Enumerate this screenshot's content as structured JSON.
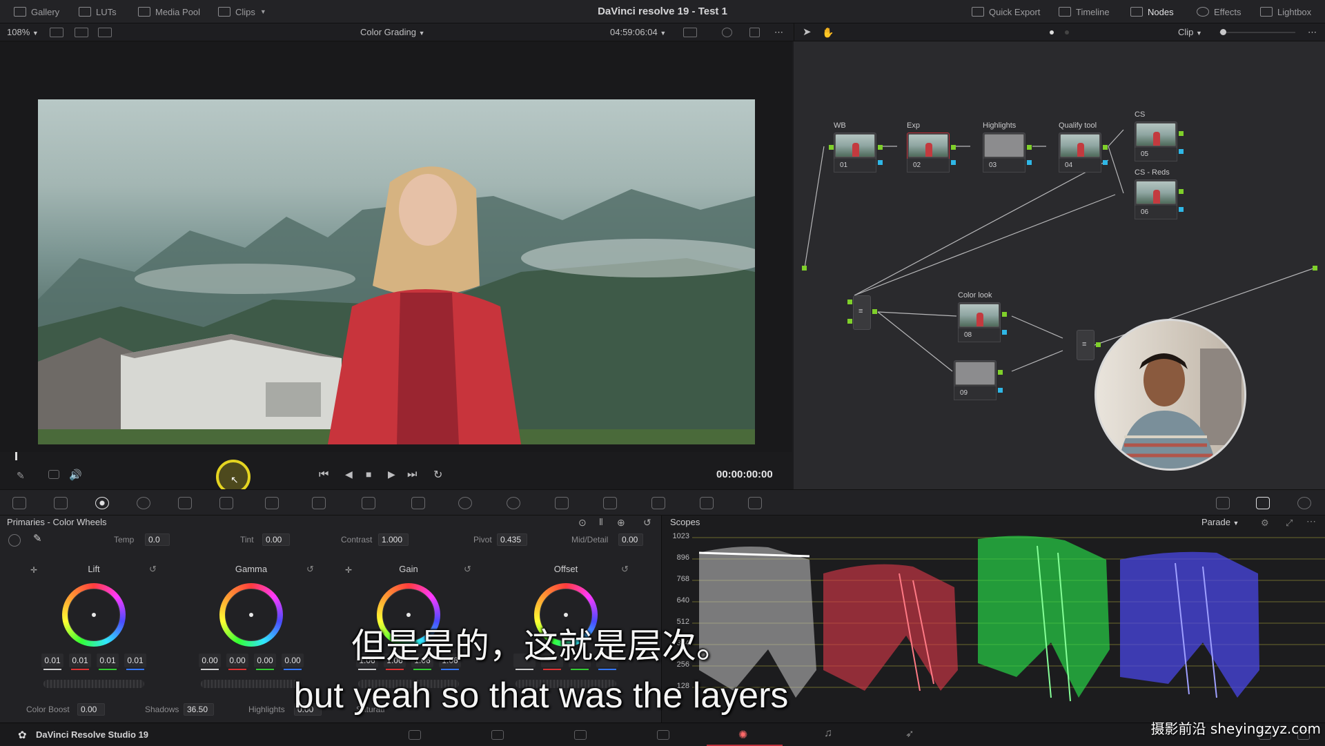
{
  "topbar": {
    "tabs": [
      {
        "label": "Gallery",
        "icon": "gallery-icon"
      },
      {
        "label": "LUTs",
        "icon": "luts-icon"
      },
      {
        "label": "Media Pool",
        "icon": "media-pool-icon"
      },
      {
        "label": "Clips",
        "icon": "clips-icon"
      }
    ],
    "title": "DaVinci resolve 19 - Test 1",
    "right_tabs": [
      {
        "label": "Quick Export",
        "icon": "export-icon"
      },
      {
        "label": "Timeline",
        "icon": "timeline-icon"
      },
      {
        "label": "Nodes",
        "icon": "nodes-icon"
      },
      {
        "label": "Effects",
        "icon": "fx-icon"
      },
      {
        "label": "Lightbox",
        "icon": "lightbox-icon"
      }
    ]
  },
  "viewer_toolbar": {
    "zoom": "108%",
    "mode": "Color Grading",
    "timecode": "04:59:06:04",
    "clip_mode": "Clip"
  },
  "transport": {
    "timecode": "00:00:00:00"
  },
  "nodes": {
    "labels": {
      "wb": "WB",
      "exp": "Exp",
      "highlights": "Highlights",
      "qualify": "Qualify tool",
      "cs": "CS",
      "cs_reds": "CS - Reds",
      "color_look": "Color look"
    },
    "numbers": {
      "wb": "01",
      "exp": "02",
      "highlights": "03",
      "qualify": "04",
      "cs": "05",
      "cs_reds": "06",
      "color_look": "08",
      "unnamed": "09"
    }
  },
  "primaries": {
    "title": "Primaries - Color Wheels",
    "temp_label": "Temp",
    "temp": "0.0",
    "tint_label": "Tint",
    "tint": "0.00",
    "contrast_label": "Contrast",
    "contrast": "1.000",
    "pivot_label": "Pivot",
    "pivot": "0.435",
    "mid_label": "Mid/Detail",
    "mid": "0.00",
    "wheels": [
      {
        "name": "Lift",
        "values": [
          "0.01",
          "0.01",
          "0.01",
          "0.01"
        ]
      },
      {
        "name": "Gamma",
        "values": [
          "0.00",
          "0.00",
          "0.00",
          "0.00"
        ]
      },
      {
        "name": "Gain",
        "values": [
          "1.06",
          "1.06",
          "1.06",
          "1.06"
        ]
      },
      {
        "name": "Offset",
        "values": [
          "",
          "",
          "",
          ""
        ]
      }
    ],
    "color_boost_label": "Color Boost",
    "color_boost": "0.00",
    "shadows_label": "Shadows",
    "shadows": "36.50",
    "highlights_label": "Highlights",
    "highlights": "0.00",
    "saturation_label": "Saturati"
  },
  "scopes": {
    "title": "Scopes",
    "mode": "Parade",
    "axis": [
      "1023",
      "896",
      "768",
      "640",
      "512",
      "384",
      "256",
      "128"
    ]
  },
  "bottom": {
    "app_name": "DaVinci Resolve Studio 19"
  },
  "subtitles": {
    "cn": "但是是的，这就是层次。",
    "en": "but yeah so that was the layers"
  },
  "watermark": "摄影前沿 sheyingzyz.com",
  "colors": {
    "accent_red": "#c0303a",
    "node_green": "#7fd02a",
    "node_blue": "#2fb7e6",
    "cursor_ring": "#e4d421"
  }
}
